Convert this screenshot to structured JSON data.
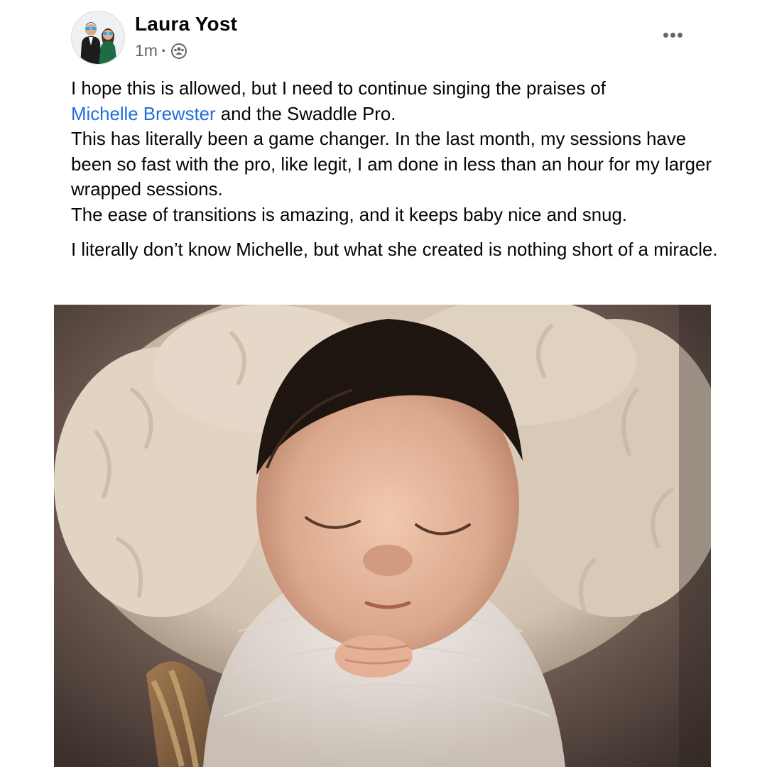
{
  "post": {
    "author_name": "Laura Yost",
    "timestamp": "1m",
    "separator": "·",
    "audience_icon": "group-audience-icon",
    "more_icon": "more-horizontal-icon",
    "text": {
      "p1_line1": "I hope this is allowed, but I need to continue singing the praises of",
      "mention": "Michelle Brewster",
      "p1_after_mention": " and the Swaddle Pro.",
      "p1_line3": "This has literally been a game changer. In the last month, my sessions have been so fast with the pro, like legit, I am done in less than an hour for my larger wrapped sessions.",
      "p1_line4": "The ease of transitions is amazing, and it keeps baby nice and snug.",
      "p2": "I literally don’t know Michelle, but what she created is nothing short of a miracle."
    },
    "photo_icon": "newborn-photo",
    "colors": {
      "author": "#050505",
      "meta": "#65676b",
      "mention": "#216fdb",
      "body_text": "#050505"
    }
  }
}
